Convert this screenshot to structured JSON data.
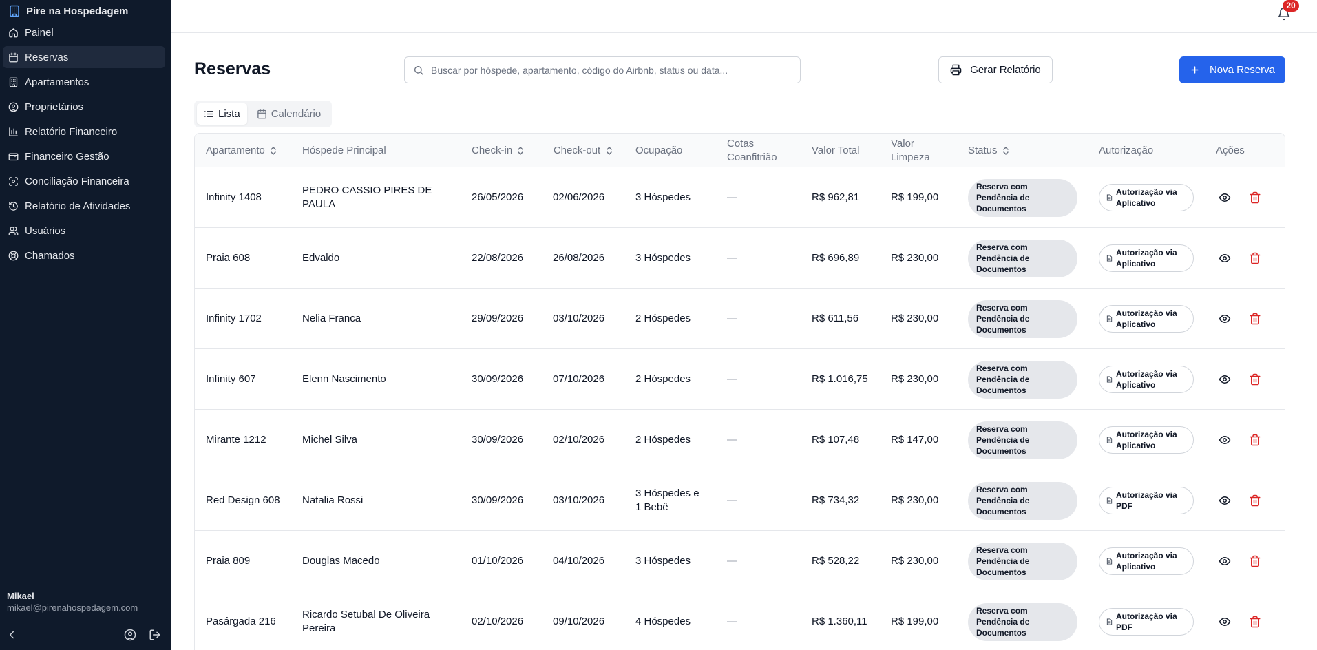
{
  "brand": {
    "name": "Pire na Hospedagem"
  },
  "sidebar": {
    "items": [
      {
        "label": "Painel",
        "icon": "home-icon"
      },
      {
        "label": "Reservas",
        "icon": "calendar-icon",
        "active": true
      },
      {
        "label": "Apartamentos",
        "icon": "building-icon"
      },
      {
        "label": "Proprietários",
        "icon": "user-circle-icon"
      },
      {
        "label": "Relatório Financeiro",
        "icon": "bar-chart-icon"
      },
      {
        "label": "Financeiro Gestão",
        "icon": "wallet-icon"
      },
      {
        "label": "Conciliação Financeira",
        "icon": "scan-icon"
      },
      {
        "label": "Relatório de Atividades",
        "icon": "history-icon"
      },
      {
        "label": "Usuários",
        "icon": "users-icon"
      },
      {
        "label": "Chamados",
        "icon": "lifebuoy-icon"
      }
    ],
    "user": {
      "name": "Mikael",
      "email": "mikael@pirenahospedagem.com"
    }
  },
  "topbar": {
    "notifications_count": "20"
  },
  "page": {
    "title": "Reservas",
    "search_placeholder": "Buscar por hóspede, apartamento, código do Airbnb, status ou data...",
    "report_button": "Gerar Relatório",
    "new_button": "Nova Reserva",
    "tabs": {
      "list": "Lista",
      "calendar": "Calendário"
    }
  },
  "table": {
    "headers": {
      "apartment": "Apartamento",
      "guest": "Hóspede Principal",
      "checkin": "Check-in",
      "checkout": "Check-out",
      "occupancy": "Ocupação",
      "cohost": "Cotas Coanfitrião",
      "total": "Valor Total",
      "cleaning": "Valor Limpeza",
      "status": "Status",
      "authorization": "Autorização",
      "actions": "Ações"
    },
    "rows": [
      {
        "apartment": "Infinity 1408",
        "guest": "PEDRO CASSIO PIRES DE PAULA",
        "checkin": "26/05/2026",
        "checkout": "02/06/2026",
        "occupancy": "3 Hóspedes",
        "cohost": "—",
        "total": "R$ 962,81",
        "cleaning": "R$ 199,00",
        "status": "Reserva com Pendência de Documentos",
        "authorization": "Autorização via Aplicativo"
      },
      {
        "apartment": "Praia 608",
        "guest": "Edvaldo",
        "checkin": "22/08/2026",
        "checkout": "26/08/2026",
        "occupancy": "3 Hóspedes",
        "cohost": "—",
        "total": "R$ 696,89",
        "cleaning": "R$ 230,00",
        "status": "Reserva com Pendência de Documentos",
        "authorization": "Autorização via Aplicativo"
      },
      {
        "apartment": "Infinity 1702",
        "guest": "Nelia Franca",
        "checkin": "29/09/2026",
        "checkout": "03/10/2026",
        "occupancy": "2 Hóspedes",
        "cohost": "—",
        "total": "R$ 611,56",
        "cleaning": "R$ 230,00",
        "status": "Reserva com Pendência de Documentos",
        "authorization": "Autorização via Aplicativo"
      },
      {
        "apartment": "Infinity 607",
        "guest": "Elenn Nascimento",
        "checkin": "30/09/2026",
        "checkout": "07/10/2026",
        "occupancy": "2 Hóspedes",
        "cohost": "—",
        "total": "R$ 1.016,75",
        "cleaning": "R$ 230,00",
        "status": "Reserva com Pendência de Documentos",
        "authorization": "Autorização via Aplicativo"
      },
      {
        "apartment": "Mirante 1212",
        "guest": "Michel Silva",
        "checkin": "30/09/2026",
        "checkout": "02/10/2026",
        "occupancy": "2 Hóspedes",
        "cohost": "—",
        "total": "R$ 107,48",
        "cleaning": "R$ 147,00",
        "status": "Reserva com Pendência de Documentos",
        "authorization": "Autorização via Aplicativo"
      },
      {
        "apartment": "Red Design 608",
        "guest": "Natalia Rossi",
        "checkin": "30/09/2026",
        "checkout": "03/10/2026",
        "occupancy": "3 Hóspedes e 1 Bebê",
        "cohost": "—",
        "total": "R$ 734,32",
        "cleaning": "R$ 230,00",
        "status": "Reserva com Pendência de Documentos",
        "authorization": "Autorização via PDF"
      },
      {
        "apartment": "Praia 809",
        "guest": "Douglas Macedo",
        "checkin": "01/10/2026",
        "checkout": "04/10/2026",
        "occupancy": "3 Hóspedes",
        "cohost": "—",
        "total": "R$ 528,22",
        "cleaning": "R$ 230,00",
        "status": "Reserva com Pendência de Documentos",
        "authorization": "Autorização via Aplicativo"
      },
      {
        "apartment": "Pasárgada 216",
        "guest": "Ricardo Setubal De Oliveira Pereira",
        "checkin": "02/10/2026",
        "checkout": "09/10/2026",
        "occupancy": "4 Hóspedes",
        "cohost": "—",
        "total": "R$ 1.360,11",
        "cleaning": "R$ 199,00",
        "status": "Reserva com Pendência de Documentos",
        "authorization": "Autorização via PDF"
      }
    ]
  },
  "colors": {
    "sidebar_bg": "#0f1a2b",
    "primary": "#2563eb",
    "danger": "#dc2626",
    "pill_bg": "#e5e7eb"
  }
}
